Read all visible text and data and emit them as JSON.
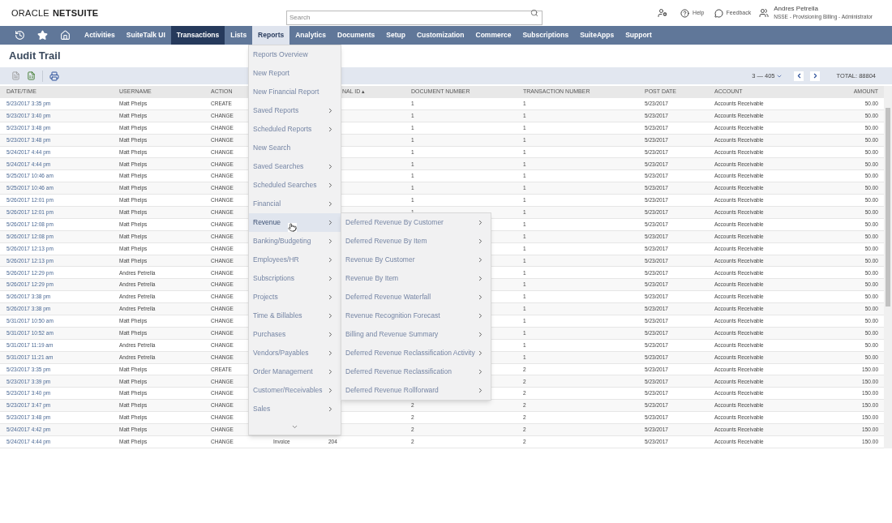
{
  "header": {
    "logo_left": "ORACLE",
    "logo_right": "NETSUITE",
    "search": {
      "placeholder": "Search"
    },
    "help": "Help",
    "feedback": "Feedback",
    "user": {
      "name": "Andres Petrella",
      "role": "NSSE - Provisioning Billing - Administrator"
    }
  },
  "nav": {
    "items": [
      {
        "label": "Activities",
        "selected": false,
        "hovered": false
      },
      {
        "label": "SuiteTalk UI",
        "selected": false,
        "hovered": false
      },
      {
        "label": "Transactions",
        "selected": false,
        "hovered": true
      },
      {
        "label": "Lists",
        "selected": false,
        "hovered": false
      },
      {
        "label": "Reports",
        "selected": true,
        "hovered": false
      },
      {
        "label": "Analytics",
        "selected": false,
        "hovered": false
      },
      {
        "label": "Documents",
        "selected": false,
        "hovered": false
      },
      {
        "label": "Setup",
        "selected": false,
        "hovered": false
      },
      {
        "label": "Customization",
        "selected": false,
        "hovered": false
      },
      {
        "label": "Commerce",
        "selected": false,
        "hovered": false
      },
      {
        "label": "Subscriptions",
        "selected": false,
        "hovered": false
      },
      {
        "label": "SuiteApps",
        "selected": false,
        "hovered": false
      },
      {
        "label": "Support",
        "selected": false,
        "hovered": false
      }
    ]
  },
  "page_title": "Audit Trail",
  "pager": {
    "range": "3 — 405",
    "total": "TOTAL: 88804"
  },
  "table": {
    "columns": [
      "DATE/TIME",
      "USERNAME",
      "ACTION",
      "",
      "NAL ID ▴",
      "DOCUMENT NUMBER",
      "TRANSACTION NUMBER",
      "POST DATE",
      "ACCOUNT",
      "AMOUNT"
    ],
    "rows": [
      {
        "date": "5/23/2017 3:35 pm",
        "username": "Matt Phelps",
        "action": "CREATE",
        "document_number": "1",
        "transaction_number": "1",
        "post_date": "5/23/2017",
        "account": "Accounts Receivable",
        "amount": "50.00"
      },
      {
        "date": "5/23/2017 3:40 pm",
        "username": "Matt Phelps",
        "action": "CHANGE",
        "document_number": "1",
        "transaction_number": "1",
        "post_date": "5/23/2017",
        "account": "Accounts Receivable",
        "amount": "50.00"
      },
      {
        "date": "5/23/2017 3:48 pm",
        "username": "Matt Phelps",
        "action": "CHANGE",
        "document_number": "1",
        "transaction_number": "1",
        "post_date": "5/23/2017",
        "account": "Accounts Receivable",
        "amount": "50.00"
      },
      {
        "date": "5/23/2017 3:48 pm",
        "username": "Matt Phelps",
        "action": "CHANGE",
        "document_number": "1",
        "transaction_number": "1",
        "post_date": "5/23/2017",
        "account": "Accounts Receivable",
        "amount": "50.00"
      },
      {
        "date": "5/24/2017 4:44 pm",
        "username": "Matt Phelps",
        "action": "CHANGE",
        "document_number": "1",
        "transaction_number": "1",
        "post_date": "5/23/2017",
        "account": "Accounts Receivable",
        "amount": "50.00"
      },
      {
        "date": "5/24/2017 4:44 pm",
        "username": "Matt Phelps",
        "action": "CHANGE",
        "document_number": "1",
        "transaction_number": "1",
        "post_date": "5/23/2017",
        "account": "Accounts Receivable",
        "amount": "50.00"
      },
      {
        "date": "5/25/2017 10:46 am",
        "username": "Matt Phelps",
        "action": "CHANGE",
        "document_number": "1",
        "transaction_number": "1",
        "post_date": "5/23/2017",
        "account": "Accounts Receivable",
        "amount": "50.00"
      },
      {
        "date": "5/25/2017 10:46 am",
        "username": "Matt Phelps",
        "action": "CHANGE",
        "document_number": "1",
        "transaction_number": "1",
        "post_date": "5/23/2017",
        "account": "Accounts Receivable",
        "amount": "50.00"
      },
      {
        "date": "5/26/2017 12:01 pm",
        "username": "Matt Phelps",
        "action": "CHANGE",
        "document_number": "1",
        "transaction_number": "1",
        "post_date": "5/23/2017",
        "account": "Accounts Receivable",
        "amount": "50.00"
      },
      {
        "date": "5/26/2017 12:01 pm",
        "username": "Matt Phelps",
        "action": "CHANGE",
        "document_number": "1",
        "transaction_number": "1",
        "post_date": "5/23/2017",
        "account": "Accounts Receivable",
        "amount": "50.00"
      },
      {
        "date": "5/26/2017 12:08 pm",
        "username": "Matt Phelps",
        "action": "CHANGE",
        "transaction_number": "1",
        "post_date": "5/23/2017",
        "account": "Accounts Receivable",
        "amount": "50.00"
      },
      {
        "date": "5/26/2017 12:08 pm",
        "username": "Matt Phelps",
        "action": "CHANGE",
        "transaction_number": "1",
        "post_date": "5/23/2017",
        "account": "Accounts Receivable",
        "amount": "50.00"
      },
      {
        "date": "5/26/2017 12:13 pm",
        "username": "Matt Phelps",
        "action": "CHANGE",
        "transaction_number": "1",
        "post_date": "5/23/2017",
        "account": "Accounts Receivable",
        "amount": "50.00"
      },
      {
        "date": "5/26/2017 12:13 pm",
        "username": "Matt Phelps",
        "action": "CHANGE",
        "transaction_number": "1",
        "post_date": "5/23/2017",
        "account": "Accounts Receivable",
        "amount": "50.00"
      },
      {
        "date": "5/26/2017 12:29 pm",
        "username": "Andres Petrella",
        "action": "CHANGE",
        "transaction_number": "1",
        "post_date": "5/23/2017",
        "account": "Accounts Receivable",
        "amount": "50.00"
      },
      {
        "date": "5/26/2017 12:29 pm",
        "username": "Andres Petrella",
        "action": "CHANGE",
        "transaction_number": "1",
        "post_date": "5/23/2017",
        "account": "Accounts Receivable",
        "amount": "50.00"
      },
      {
        "date": "5/26/2017 3:38 pm",
        "username": "Andres Petrella",
        "action": "CHANGE",
        "transaction_number": "1",
        "post_date": "5/23/2017",
        "account": "Accounts Receivable",
        "amount": "50.00"
      },
      {
        "date": "5/26/2017 3:38 pm",
        "username": "Andres Petrella",
        "action": "CHANGE",
        "transaction_number": "1",
        "post_date": "5/23/2017",
        "account": "Accounts Receivable",
        "amount": "50.00"
      },
      {
        "date": "5/31/2017 10:50 am",
        "username": "Matt Phelps",
        "action": "CHANGE",
        "transaction_number": "1",
        "post_date": "5/23/2017",
        "account": "Accounts Receivable",
        "amount": "50.00"
      },
      {
        "date": "5/31/2017 10:52 am",
        "username": "Matt Phelps",
        "action": "CHANGE",
        "transaction_number": "1",
        "post_date": "5/23/2017",
        "account": "Accounts Receivable",
        "amount": "50.00"
      },
      {
        "date": "5/31/2017 11:19 am",
        "username": "Andres Petrella",
        "action": "CHANGE",
        "transaction_number": "1",
        "post_date": "5/23/2017",
        "account": "Accounts Receivable",
        "amount": "50.00"
      },
      {
        "date": "5/31/2017 11:21 am",
        "username": "Andres Petrella",
        "action": "CHANGE",
        "transaction_number": "1",
        "post_date": "5/23/2017",
        "account": "Accounts Receivable",
        "amount": "50.00"
      },
      {
        "date": "5/23/2017 3:35 pm",
        "username": "Matt Phelps",
        "action": "CREATE",
        "transaction_number": "2",
        "post_date": "5/23/2017",
        "account": "Accounts Receivable",
        "amount": "150.00"
      },
      {
        "date": "5/23/2017 3:39 pm",
        "username": "Matt Phelps",
        "action": "CHANGE",
        "transaction_number": "2",
        "post_date": "5/23/2017",
        "account": "Accounts Receivable",
        "amount": "150.00"
      },
      {
        "date": "5/23/2017 3:40 pm",
        "username": "Matt Phelps",
        "action": "CHANGE",
        "transaction_number": "2",
        "post_date": "5/23/2017",
        "account": "Accounts Receivable",
        "amount": "150.00"
      },
      {
        "date": "5/23/2017 3:47 pm",
        "username": "Matt Phelps",
        "action": "CHANGE",
        "document_number": "2",
        "transaction_number": "2",
        "post_date": "5/23/2017",
        "account": "Accounts Receivable",
        "amount": "150.00"
      },
      {
        "date": "5/23/2017 3:48 pm",
        "username": "Matt Phelps",
        "action": "CHANGE",
        "document_number": "2",
        "transaction_number": "2",
        "post_date": "5/23/2017",
        "account": "Accounts Receivable",
        "amount": "150.00"
      },
      {
        "date": "5/24/2017 4:42 pm",
        "username": "Matt Phelps",
        "action": "CHANGE",
        "document_number": "2",
        "transaction_number": "2",
        "post_date": "5/23/2017",
        "account": "Accounts Receivable",
        "amount": "150.00"
      },
      {
        "date": "5/24/2017 4:44 pm",
        "username": "Matt Phelps",
        "action": "CHANGE",
        "type": "Invoice",
        "internal_id": "204",
        "document_number": "2",
        "transaction_number": "2",
        "post_date": "5/23/2017",
        "account": "Accounts Receivable",
        "amount": "150.00"
      }
    ]
  },
  "reports_menu": {
    "items": [
      {
        "label": "Reports Overview",
        "submenu": false,
        "selected": false
      },
      {
        "label": "New Report",
        "submenu": false,
        "selected": false
      },
      {
        "label": "New Financial Report",
        "submenu": false,
        "selected": false
      },
      {
        "label": "Saved Reports",
        "submenu": true,
        "selected": false
      },
      {
        "label": "Scheduled Reports",
        "submenu": true,
        "selected": false
      },
      {
        "label": "New Search",
        "submenu": false,
        "selected": false
      },
      {
        "label": "Saved Searches",
        "submenu": true,
        "selected": false
      },
      {
        "label": "Scheduled Searches",
        "submenu": true,
        "selected": false
      },
      {
        "label": "Financial",
        "submenu": true,
        "selected": false
      },
      {
        "label": "Revenue",
        "submenu": true,
        "selected": true
      },
      {
        "label": "Banking/Budgeting",
        "submenu": true,
        "selected": false
      },
      {
        "label": "Employees/HR",
        "submenu": true,
        "selected": false
      },
      {
        "label": "Subscriptions",
        "submenu": true,
        "selected": false
      },
      {
        "label": "Projects",
        "submenu": true,
        "selected": false
      },
      {
        "label": "Time & Billables",
        "submenu": true,
        "selected": false
      },
      {
        "label": "Purchases",
        "submenu": true,
        "selected": false
      },
      {
        "label": "Vendors/Payables",
        "submenu": true,
        "selected": false
      },
      {
        "label": "Order Management",
        "submenu": true,
        "selected": false
      },
      {
        "label": "Customer/Receivables",
        "submenu": true,
        "selected": false
      },
      {
        "label": "Sales",
        "submenu": true,
        "selected": false
      }
    ]
  },
  "revenue_submenu": {
    "items": [
      {
        "label": "Deferred Revenue By Customer",
        "submenu": true,
        "selected": false
      },
      {
        "label": "Deferred Revenue By Item",
        "submenu": true,
        "selected": false
      },
      {
        "label": "Revenue By Customer",
        "submenu": true,
        "selected": false
      },
      {
        "label": "Revenue By Item",
        "submenu": true,
        "selected": false
      },
      {
        "label": "Deferred Revenue Waterfall",
        "submenu": true,
        "selected": false
      },
      {
        "label": "Revenue Recognition Forecast",
        "submenu": true,
        "selected": false
      },
      {
        "label": "Billing and Revenue Summary",
        "submenu": true,
        "selected": false
      },
      {
        "label": "Deferred Revenue Reclassification Activity",
        "submenu": true,
        "selected": false
      },
      {
        "label": "Deferred Revenue Reclassification",
        "submenu": true,
        "selected": false
      },
      {
        "label": "Deferred Revenue Rollforward",
        "submenu": true,
        "selected": false
      }
    ]
  }
}
